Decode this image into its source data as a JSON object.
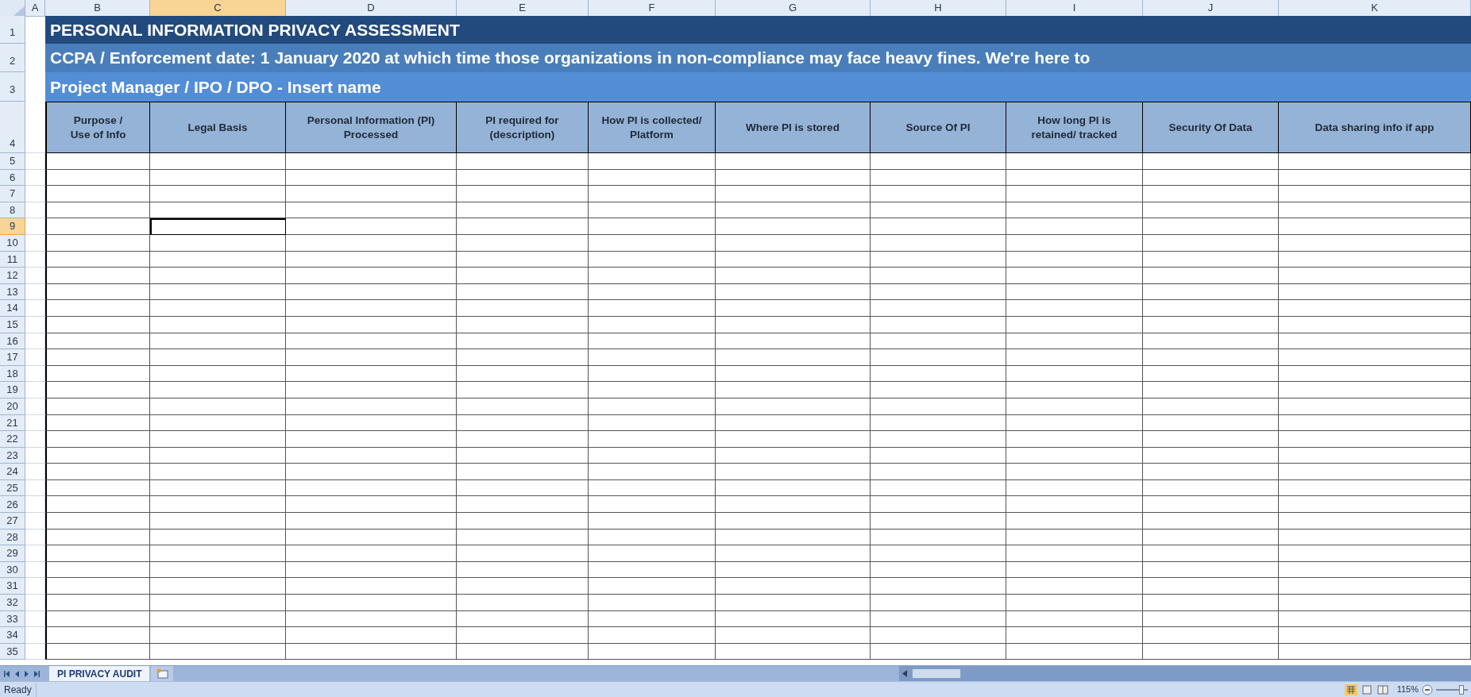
{
  "column_headers": [
    {
      "label": "A",
      "selected": false
    },
    {
      "label": "B",
      "selected": false
    },
    {
      "label": "C",
      "selected": true
    },
    {
      "label": "D",
      "selected": false
    },
    {
      "label": "E",
      "selected": false
    },
    {
      "label": "F",
      "selected": false
    },
    {
      "label": "G",
      "selected": false
    },
    {
      "label": "H",
      "selected": false
    },
    {
      "label": "I",
      "selected": false
    },
    {
      "label": "J",
      "selected": false
    },
    {
      "label": "K",
      "selected": false
    }
  ],
  "title_rows": [
    {
      "row": "1",
      "kind": "title",
      "text": "PERSONAL INFORMATION PRIVACY ASSESSMENT"
    },
    {
      "row": "2",
      "kind": "subtitle",
      "text": "CCPA / Enforcement date: 1 January 2020 at which time those organizations in non-compliance may face heavy fines. We're here to"
    },
    {
      "row": "3",
      "kind": "owner",
      "text": "Project Manager / IPO / DPO -  Insert name"
    }
  ],
  "header_row": {
    "row": "4",
    "cells": [
      "Purpose  /\nUse of Info",
      "Legal Basis",
      "Personal Information (PI)\nProcessed",
      "PI required for\n(description)",
      "How PI is collected/\nPlatform",
      "Where PI is stored",
      "Source Of PI",
      "How long PI is\nretained/ tracked",
      "Security Of Data",
      "Data sharing info if app"
    ]
  },
  "body_rows": [
    {
      "row": "5",
      "selected": false
    },
    {
      "row": "6",
      "selected": false
    },
    {
      "row": "7",
      "selected": false
    },
    {
      "row": "8",
      "selected": false
    },
    {
      "row": "9",
      "selected": true
    },
    {
      "row": "10",
      "selected": false
    },
    {
      "row": "11",
      "selected": false
    },
    {
      "row": "12",
      "selected": false
    },
    {
      "row": "13",
      "selected": false
    },
    {
      "row": "14",
      "selected": false
    },
    {
      "row": "15",
      "selected": false
    },
    {
      "row": "16",
      "selected": false
    },
    {
      "row": "17",
      "selected": false
    },
    {
      "row": "18",
      "selected": false
    },
    {
      "row": "19",
      "selected": false
    },
    {
      "row": "20",
      "selected": false
    },
    {
      "row": "21",
      "selected": false
    },
    {
      "row": "22",
      "selected": false
    },
    {
      "row": "23",
      "selected": false
    },
    {
      "row": "24",
      "selected": false
    },
    {
      "row": "25",
      "selected": false
    },
    {
      "row": "26",
      "selected": false
    },
    {
      "row": "27",
      "selected": false
    },
    {
      "row": "28",
      "selected": false
    },
    {
      "row": "29",
      "selected": false
    },
    {
      "row": "30",
      "selected": false
    },
    {
      "row": "31",
      "selected": false
    },
    {
      "row": "32",
      "selected": false
    },
    {
      "row": "33",
      "selected": false
    },
    {
      "row": "34",
      "selected": false
    },
    {
      "row": "35",
      "selected": false
    }
  ],
  "sheet_tabs": [
    {
      "label": "PI PRIVACY AUDIT",
      "selected": true
    }
  ],
  "status_bar": {
    "text": "Ready",
    "zoom": "115%",
    "zoom_slider": {
      "level": 0.85
    }
  }
}
